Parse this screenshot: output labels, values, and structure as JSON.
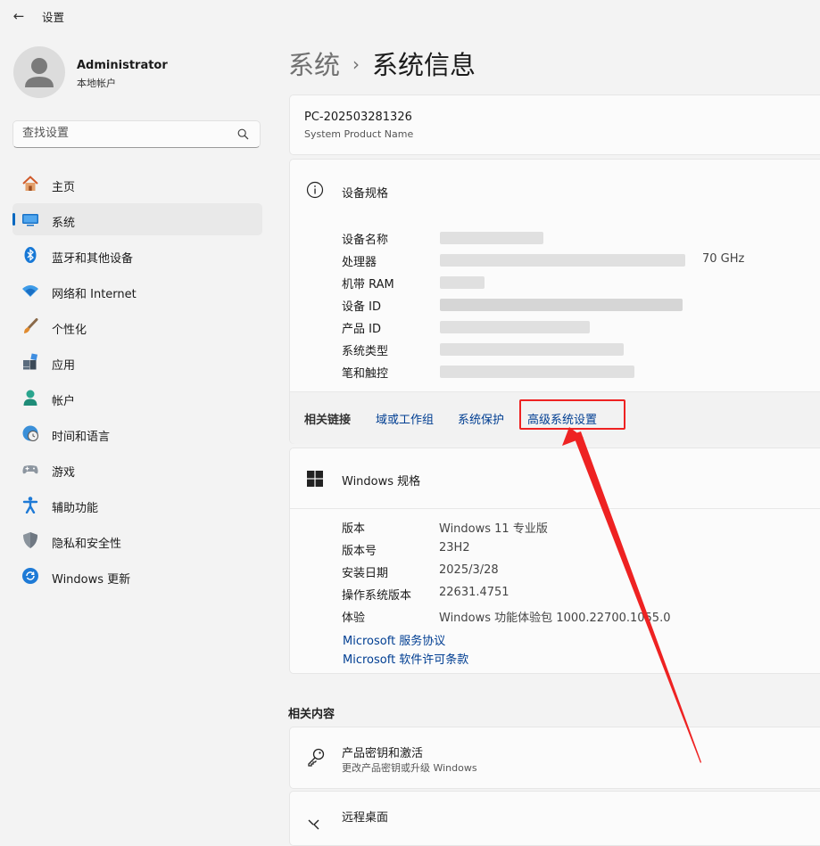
{
  "app": {
    "title": "设置"
  },
  "user": {
    "name": "Administrator",
    "account_type": "本地帐户"
  },
  "search": {
    "placeholder": "查找设置"
  },
  "nav": {
    "items": [
      {
        "label": "主页",
        "icon": "home-icon"
      },
      {
        "label": "系统",
        "icon": "system-icon",
        "active": true
      },
      {
        "label": "蓝牙和其他设备",
        "icon": "bluetooth-icon"
      },
      {
        "label": "网络和 Internet",
        "icon": "wifi-icon"
      },
      {
        "label": "个性化",
        "icon": "brush-icon"
      },
      {
        "label": "应用",
        "icon": "apps-icon"
      },
      {
        "label": "帐户",
        "icon": "account-icon"
      },
      {
        "label": "时间和语言",
        "icon": "time-language-icon"
      },
      {
        "label": "游戏",
        "icon": "gamepad-icon"
      },
      {
        "label": "辅助功能",
        "icon": "accessibility-icon"
      },
      {
        "label": "隐私和安全性",
        "icon": "shield-icon"
      },
      {
        "label": "Windows 更新",
        "icon": "update-icon"
      }
    ]
  },
  "breadcrumb": {
    "parent": "系统",
    "separator": "›",
    "current": "系统信息"
  },
  "pc": {
    "name": "PC-202503281326",
    "product_name": "System Product Name"
  },
  "device_specs": {
    "title": "设备规格",
    "rows": [
      {
        "label": "设备名称",
        "value": ""
      },
      {
        "label": "处理器",
        "value": "70 GHz"
      },
      {
        "label": "机带 RAM",
        "value": ""
      },
      {
        "label": "设备 ID",
        "value": ""
      },
      {
        "label": "产品 ID",
        "value": ""
      },
      {
        "label": "系统类型",
        "value": ""
      },
      {
        "label": "笔和触控",
        "value": ""
      }
    ]
  },
  "related_links": {
    "label": "相关链接",
    "links": [
      "域或工作组",
      "系统保护",
      "高级系统设置"
    ]
  },
  "windows_specs": {
    "title": "Windows 规格",
    "rows": [
      {
        "label": "版本",
        "value": "Windows 11 专业版"
      },
      {
        "label": "版本号",
        "value": "23H2"
      },
      {
        "label": "安装日期",
        "value": "2025/3/28"
      },
      {
        "label": "操作系统版本",
        "value": "22631.4751"
      },
      {
        "label": "体验",
        "value": "Windows 功能体验包 1000.22700.1055.0"
      }
    ],
    "links": [
      "Microsoft 服务协议",
      "Microsoft 软件许可条款"
    ]
  },
  "related_content": {
    "title": "相关内容",
    "items": [
      {
        "title": "产品密钥和激活",
        "subtitle": "更改产品密钥或升级 Windows",
        "icon": "key-icon"
      },
      {
        "title": "远程桌面",
        "subtitle": "",
        "icon": "remote-desktop-icon"
      }
    ]
  },
  "colors": {
    "accent": "#0067c0",
    "link": "#003e92",
    "annotation": "#e22222"
  }
}
